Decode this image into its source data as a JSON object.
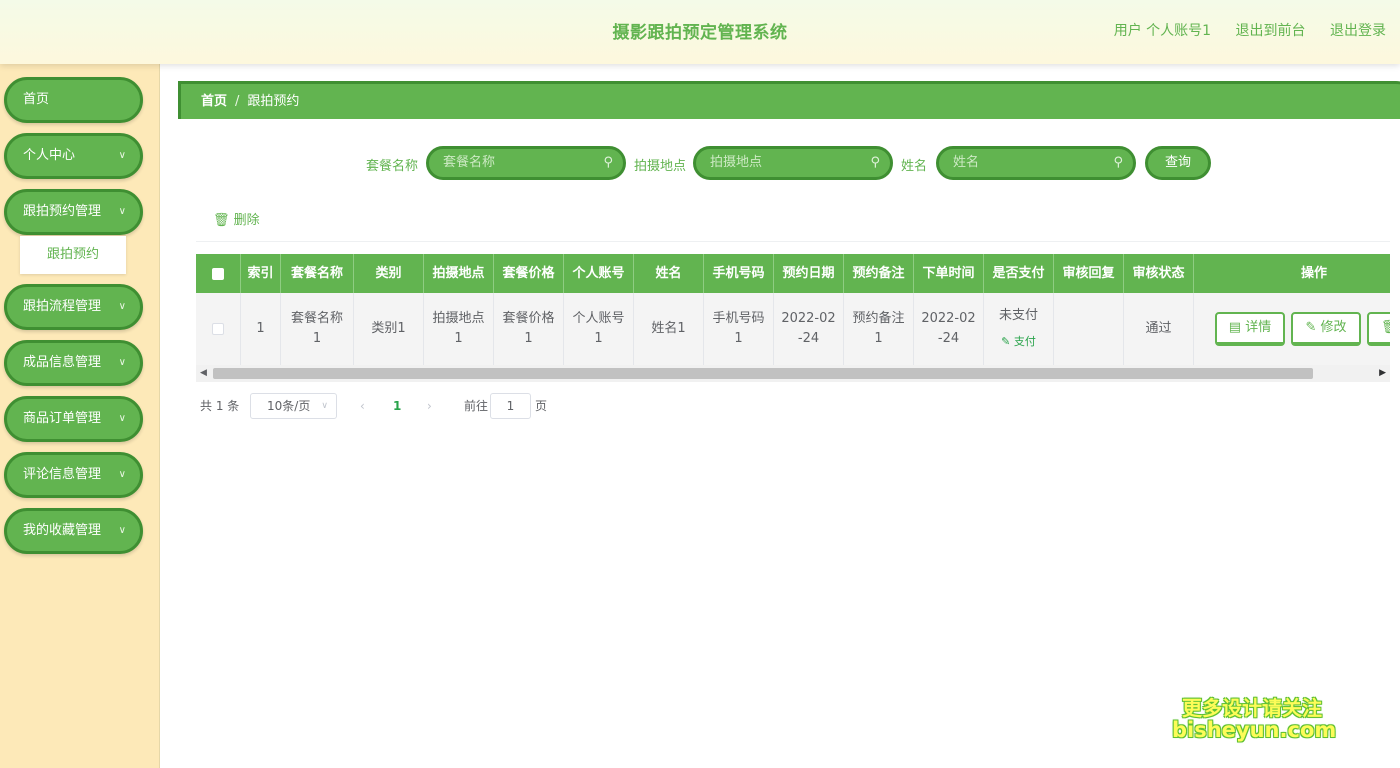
{
  "header": {
    "title": "摄影跟拍预定管理系统",
    "user_label": "用户 个人账号1",
    "back_to_front": "退出到前台",
    "logout": "退出登录"
  },
  "sidebar": {
    "items": [
      {
        "label": "首页",
        "has_children": false
      },
      {
        "label": "个人中心",
        "has_children": true
      },
      {
        "label": "跟拍预约管理",
        "has_children": true
      },
      {
        "label": "跟拍流程管理",
        "has_children": true
      },
      {
        "label": "成品信息管理",
        "has_children": true
      },
      {
        "label": "商品订单管理",
        "has_children": true
      },
      {
        "label": "评论信息管理",
        "has_children": true
      },
      {
        "label": "我的收藏管理",
        "has_children": true
      }
    ],
    "active_submenu": "跟拍预约"
  },
  "breadcrumb": {
    "home": "首页",
    "separator": "/",
    "current": "跟拍预约"
  },
  "search": {
    "fields": [
      {
        "label": "套餐名称",
        "placeholder": "套餐名称"
      },
      {
        "label": "拍摄地点",
        "placeholder": "拍摄地点"
      },
      {
        "label": "姓名",
        "placeholder": "姓名"
      }
    ],
    "query_label": "查询"
  },
  "toolbar": {
    "delete_label": "删除"
  },
  "table": {
    "columns": [
      "索引",
      "套餐名称",
      "类别",
      "拍摄地点",
      "套餐价格",
      "个人账号",
      "姓名",
      "手机号码",
      "预约日期",
      "预约备注",
      "下单时间",
      "是否支付",
      "审核回复",
      "审核状态",
      "操作"
    ],
    "rows": [
      {
        "index": "1",
        "package_name": "套餐名称1",
        "category": "类别1",
        "location": "拍摄地点1",
        "price": "套餐价格1",
        "account": "个人账号1",
        "name": "姓名1",
        "phone": "手机号码1",
        "date": "2022-02-24",
        "remark": "预约备注1",
        "order_time": "2022-02-24",
        "paid": "未支付",
        "pay_action": "支付",
        "review_reply": "",
        "review_status": "通过"
      }
    ],
    "actions": {
      "detail": "详情",
      "edit": "修改"
    }
  },
  "pagination": {
    "total": "共 1 条",
    "page_size": "10条/页",
    "current_page": "1",
    "goto_label": "前往",
    "goto_value": "1",
    "page_suffix": "页"
  },
  "watermark": {
    "line1": "更多设计请关注",
    "line2": "bisheyun.com"
  },
  "colors": {
    "primary": "#62b450",
    "primary_dark": "#3f8f32",
    "sidebar_bg": "#fde9b8",
    "link_green": "#29a34b"
  }
}
